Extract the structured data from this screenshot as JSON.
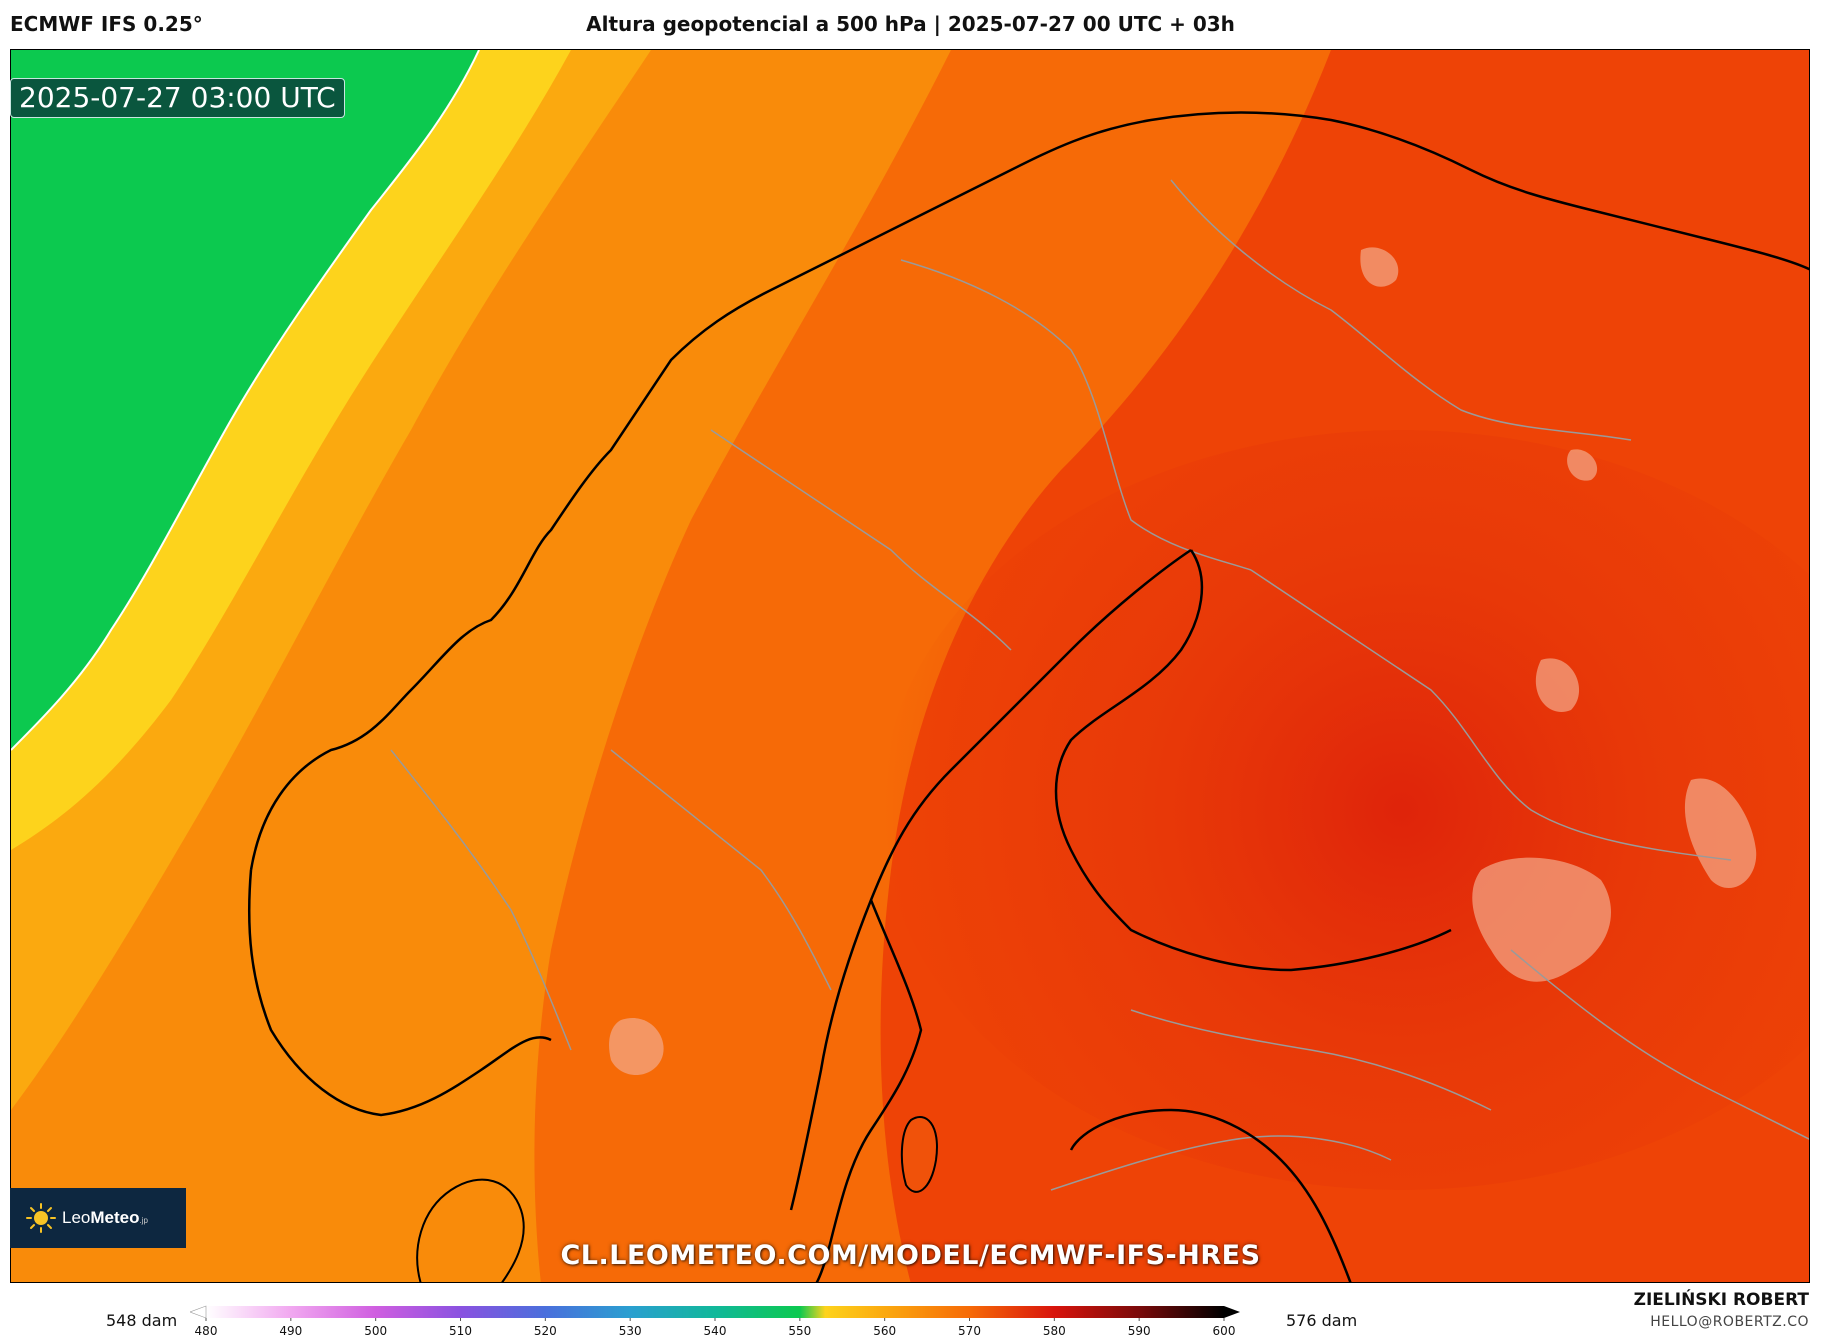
{
  "header": {
    "model": "ECMWF IFS 0.25°",
    "title": "Altura geopotencial a 500 hPa | 2025-07-27 00 UTC + 03h"
  },
  "map": {
    "valid_time": "2025-07-27 03:00 UTC",
    "region": "Scandinavia / Baltic",
    "url_watermark": "CL.LEOMETEO.COM/MODEL/ECMWF-IFS-HRES",
    "colors": {
      "green_zone": "#0cc94f",
      "yellow_zone": "#fdd31c",
      "light_orange": "#fba90f",
      "orange": "#f98b0a",
      "dark_orange": "#f66a07",
      "red_orange": "#ee4306",
      "red": "#e3260a",
      "coastline": "#000000",
      "borders": "#9a9a9a"
    }
  },
  "logo": {
    "brand_light": "Leo",
    "brand_bold": "Meteo",
    "suffix": ".jp",
    "icon": "sun-icon"
  },
  "legend": {
    "min_label": "548 dam",
    "max_label": "576 dam",
    "ticks": [
      "480",
      "490",
      "500",
      "510",
      "520",
      "530",
      "540",
      "550",
      "560",
      "570",
      "580",
      "590",
      "600"
    ],
    "stops": [
      {
        "value": 480,
        "color": "#ffffff"
      },
      {
        "value": 490,
        "color": "#f1a8f0"
      },
      {
        "value": 500,
        "color": "#cf5ee0"
      },
      {
        "value": 510,
        "color": "#8a52e0"
      },
      {
        "value": 520,
        "color": "#4a6fdc"
      },
      {
        "value": 530,
        "color": "#2a9fd0"
      },
      {
        "value": 540,
        "color": "#11b89a"
      },
      {
        "value": 550,
        "color": "#0cc94f"
      },
      {
        "value": 553,
        "color": "#fdd31c"
      },
      {
        "value": 560,
        "color": "#fba90f"
      },
      {
        "value": 570,
        "color": "#f66a07"
      },
      {
        "value": 580,
        "color": "#d8140c"
      },
      {
        "value": 590,
        "color": "#7a0a0a"
      },
      {
        "value": 600,
        "color": "#000000"
      }
    ]
  },
  "credit": {
    "name": "ZIELIŃSKI ROBERT",
    "email": "HELLO@ROBERTZ.CO"
  }
}
